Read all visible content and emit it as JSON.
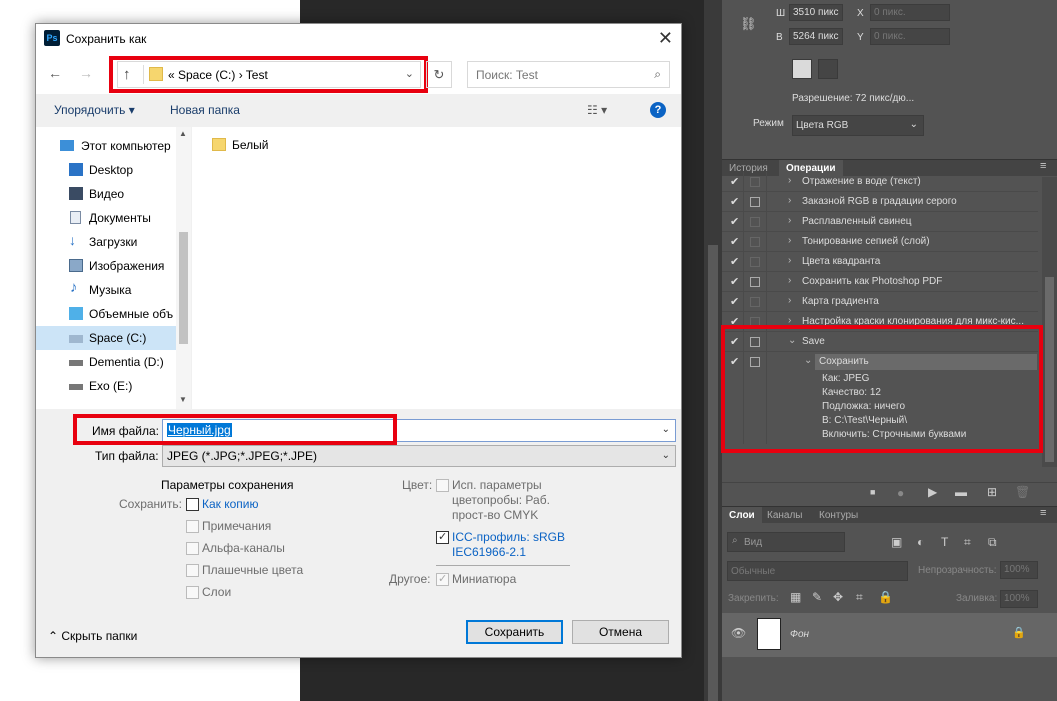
{
  "dialog": {
    "title": "Сохранить как",
    "app_logo": "Ps",
    "close": "✕",
    "address_path": "«  Space (C:)  ›  Test",
    "search_placeholder": "Поиск: Test",
    "toolbar": {
      "organize": "Упорядочить ▾",
      "new_folder": "Новая папка",
      "help": "?"
    },
    "tree": [
      {
        "label": "Этот компьютер",
        "icon": "computer-icon"
      },
      {
        "label": "Desktop",
        "icon": "desktop-icon"
      },
      {
        "label": "Видео",
        "icon": "video-icon"
      },
      {
        "label": "Документы",
        "icon": "documents-icon"
      },
      {
        "label": "Загрузки",
        "icon": "downloads-icon"
      },
      {
        "label": "Изображения",
        "icon": "images-icon"
      },
      {
        "label": "Музыка",
        "icon": "music-icon"
      },
      {
        "label": "Объемные объ",
        "icon": "3d-objects-icon"
      },
      {
        "label": "Space (C:)",
        "icon": "drive-icon",
        "selected": true
      },
      {
        "label": "Dementia (D:)",
        "icon": "drive-icon"
      },
      {
        "label": "Exo (E:)",
        "icon": "drive-icon"
      }
    ],
    "files": [
      {
        "name": "Белый",
        "icon": "folder-icon"
      }
    ],
    "filename_label": "Имя файла:",
    "filename_value": "Черный.jpg",
    "filetype_label": "Тип файла:",
    "filetype_value": "JPEG (*.JPG;*.JPEG;*.JPE)",
    "save_options": {
      "heading": "Параметры сохранения",
      "save_label": "Сохранить:",
      "as_copy": "Как копию",
      "notes": "Примечания",
      "alpha": "Альфа-каналы",
      "spot": "Плашечные цвета",
      "layers": "Слои"
    },
    "color": {
      "label": "Цвет:",
      "proof_line1": "Исп. параметры",
      "proof_line2": "цветопробы:  Раб.",
      "proof_line3": "прост-во CMYK",
      "icc_line1": "ICC-профиль:  sRGB",
      "icc_line2": "IEC61966-2.1"
    },
    "other": {
      "label": "Другое:",
      "thumbnail": "Миниатюра"
    },
    "hide_folders": "Скрыть папки",
    "save_button": "Сохранить",
    "cancel_button": "Отмена"
  },
  "photoshop": {
    "w_label": "Ш",
    "w_value": "3510 пикс",
    "x_label": "X",
    "x_value": "0 пикс.",
    "h_label": "В",
    "h_value": "5264 пикс",
    "y_label": "Y",
    "y_value": "0 пикс.",
    "resolution": "Разрешение: 72 пикс/дю...",
    "mode_label": "Режим",
    "mode_value": "Цвета RGB",
    "tabs": {
      "history": "История",
      "actions": "Операции"
    },
    "actions": [
      {
        "name": "Отражение в воде (текст)",
        "box": false
      },
      {
        "name": "Заказной RGB в градации серого",
        "box": true
      },
      {
        "name": "Расплавленный свинец",
        "box": false
      },
      {
        "name": "Тонирование сепией (слой)",
        "box": false
      },
      {
        "name": "Цвета квадранта",
        "box": false
      },
      {
        "name": "Сохранить как Photoshop PDF",
        "box": true
      },
      {
        "name": "Карта градиента",
        "box": false
      },
      {
        "name": "Настройка краски клонирования для микс-кис...",
        "box": false
      }
    ],
    "save_set": "Save",
    "save_step": "Сохранить",
    "details": [
      "Как:  JPEG",
      "Качество:  12",
      "Подложка:  ничего",
      "В:   C:\\Test\\Черный\\",
      "Включить: Строчными буквами"
    ],
    "layer_tabs": {
      "layers": "Слои",
      "channels": "Каналы",
      "paths": "Контуры"
    },
    "kind": "Вид",
    "blend": "Обычные",
    "opacity_label": "Непрозрачность:",
    "opacity_value": "100%",
    "lock_label": "Закрепить:",
    "fill_label": "Заливка:",
    "fill_value": "100%",
    "layer_name": "Фон"
  },
  "colors": {
    "highlight": "#e8000f",
    "selection": "#0078d7",
    "ps_panel": "#535353"
  }
}
